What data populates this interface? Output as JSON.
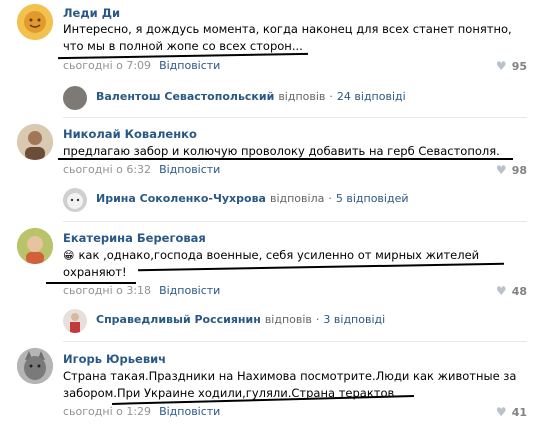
{
  "comments": [
    {
      "author": "Леди Ди",
      "lines": [
        "Интересно, я дождусь момента, когда наконец для всех станет понятно,",
        "что мы в полной жопе со всех сторон..."
      ],
      "time": "сьогодні о 7:09",
      "reply_label": "Відповісти",
      "likes": "95",
      "avatar_icon": "sun-face-avatar"
    },
    {
      "author": "Николай Коваленко",
      "lines": [
        "предлагаю забор и колючую проволоку добавить на герб Севастополя."
      ],
      "time": "сьогодні о 6:32",
      "reply_label": "Відповісти",
      "likes": "98",
      "avatar_icon": "person-photo-avatar"
    },
    {
      "author": "Екатерина Береговая",
      "emoji": "😁",
      "lines": [
        "как ,однако,господа военные, себя усиленно от мирных жителей",
        "охраняют!"
      ],
      "time": "сьогодні о 3:18",
      "reply_label": "Відповісти",
      "likes": "48",
      "avatar_icon": "child-photo-avatar"
    },
    {
      "author": "Игорь Юрьевич",
      "lines": [
        "Страна такая.Праздники на Нахимова посмотрите.Люди как животные за",
        "забором.При Украине ходили,гуляли.Страна терактов"
      ],
      "time": "сьогодні о 1:29",
      "reply_label": "Відповісти",
      "likes": "41",
      "avatar_icon": "cat-photo-avatar"
    }
  ],
  "replies": [
    {
      "name": "Валентош Севастопольский",
      "verb": "відповів",
      "count": "24 відповіді"
    },
    {
      "name": "Ирина Соколенко-Чухрова",
      "verb": "відповіла",
      "count": "5 відповідей"
    },
    {
      "name": "Справедливый Россиянин",
      "verb": "відповів",
      "count": "3 відповіді"
    }
  ],
  "colors": {
    "link": "#2a5885",
    "meta": "#939393",
    "divider": "#e7e8ec",
    "underline": "#000000"
  }
}
